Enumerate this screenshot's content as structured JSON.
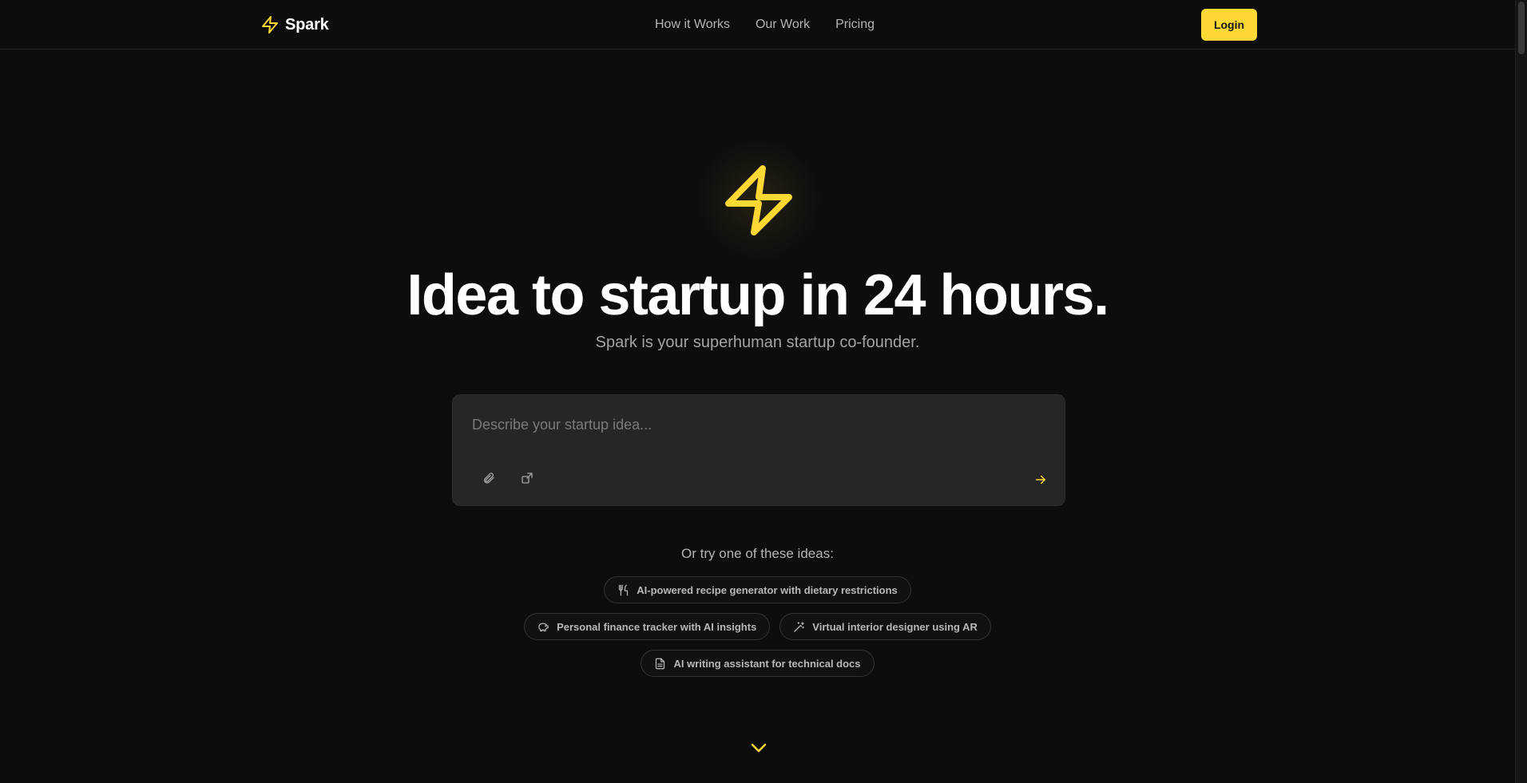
{
  "colors": {
    "accent": "#fdd835",
    "background": "#0d0d0d",
    "panel": "#262626"
  },
  "header": {
    "logo_text": "Spark",
    "logo_icon": "lightning-bolt-icon",
    "nav": [
      {
        "label": "How it Works"
      },
      {
        "label": "Our Work"
      },
      {
        "label": "Pricing"
      }
    ],
    "login_label": "Login"
  },
  "hero": {
    "icon": "lightning-bolt-icon",
    "title": "Idea to startup in 24 hours.",
    "subtitle": "Spark is your superhuman startup co-founder."
  },
  "prompt": {
    "placeholder": "Describe your startup idea...",
    "value": "",
    "tools": [
      {
        "icon": "paperclip-icon"
      },
      {
        "icon": "share-icon"
      }
    ],
    "send_icon": "arrow-right-icon"
  },
  "ideas": {
    "label": "Or try one of these ideas:",
    "chips": [
      {
        "label": "AI-powered recipe generator with dietary restrictions",
        "icon": "utensils-icon"
      },
      {
        "label": "Personal finance tracker with AI insights",
        "icon": "piggy-bank-icon"
      },
      {
        "label": "Virtual interior designer using AR",
        "icon": "magic-wand-icon"
      },
      {
        "label": "AI writing assistant for technical docs",
        "icon": "document-icon"
      }
    ]
  },
  "scroll_icon": "chevron-down-icon"
}
